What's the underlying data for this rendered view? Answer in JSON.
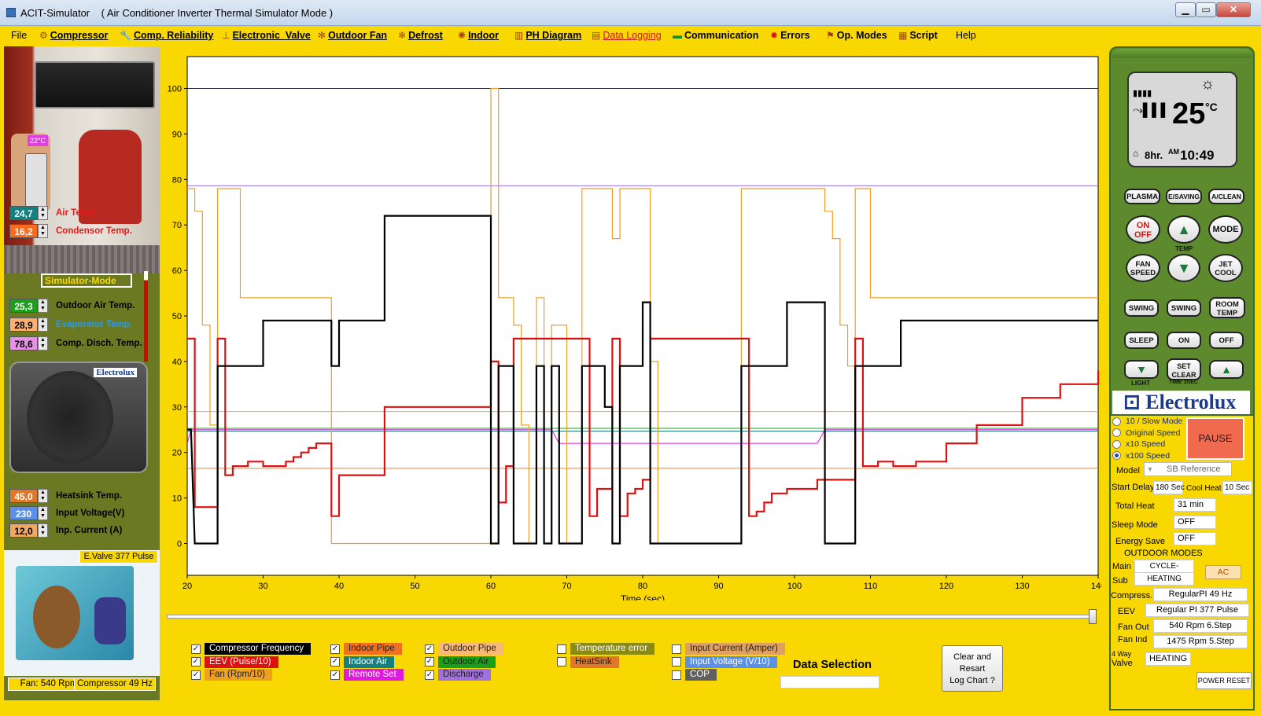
{
  "window": {
    "app_name": "ACIT-Simulator",
    "subtitle": "( Air Conditioner Inverter Thermal Simulator  Mode )",
    "min": "▁",
    "max": "▭",
    "close": "✕"
  },
  "menu": [
    {
      "label": "File",
      "icon": "",
      "style": "plain"
    },
    {
      "label": "Compressor",
      "icon": "compressor-icon",
      "style": "u"
    },
    {
      "label": "Comp. Reliability",
      "icon": "wrench-icon",
      "style": "u"
    },
    {
      "label": "Electronic_Valve",
      "icon": "valve-icon",
      "style": "u"
    },
    {
      "label": "Outdoor Fan",
      "icon": "fan-icon",
      "style": "u"
    },
    {
      "label": "Defrost",
      "icon": "defrost-icon",
      "style": "u"
    },
    {
      "label": "Indoor",
      "icon": "indoor-icon",
      "style": "u"
    },
    {
      "label": "PH Diagram",
      "icon": "chart-icon",
      "style": "u"
    },
    {
      "label": "Data Logging",
      "icon": "log-icon",
      "style": "u-red"
    },
    {
      "label": "Communication",
      "icon": "comm-icon",
      "style": "b"
    },
    {
      "label": "Errors",
      "icon": "error-icon",
      "style": "b"
    },
    {
      "label": "Op. Modes",
      "icon": "modes-icon",
      "style": "b"
    },
    {
      "label": "Script",
      "icon": "script-icon",
      "style": "b"
    },
    {
      "label": "Help",
      "icon": "",
      "style": "plain"
    }
  ],
  "left": {
    "remote_temp": "22°C",
    "air_temp": {
      "value": "24,7",
      "label": "Air Temp.",
      "bg": "#148080",
      "color": "#e81818"
    },
    "condensor_temp": {
      "value": "16,2",
      "label": "Condensor Temp.",
      "bg": "#ff6a1a",
      "color": "#e81818"
    },
    "sim_mode": "Simulator-Mode",
    "outdoor_air": {
      "value": "25,3",
      "label": "Outdoor Air Temp.",
      "bg": "#1aa01a"
    },
    "evaporator": {
      "value": "28,9",
      "label": "Evaporator Temp.",
      "bg": "#ffb070",
      "color": "#2a9ae8"
    },
    "comp_disch": {
      "value": "78,6",
      "label": "Comp. Disch. Temp.",
      "bg": "#e890e8"
    },
    "outdoor_brand": "Electrolux",
    "heatsink": {
      "value": "45,0",
      "label": "Heatsink Temp.",
      "bg": "#e07828"
    },
    "input_voltage": {
      "value": "230",
      "label": "Input Voltage(V)",
      "bg": "#5a90e8"
    },
    "input_current": {
      "value": "12,0",
      "label": "Inp. Current (A)",
      "bg": "#f0a860"
    },
    "evalve": "E.Valve 377 Pulse",
    "fan": "Fan: 540 Rpm",
    "compressor": "Compressor 49 Hz"
  },
  "chart_data": {
    "type": "line",
    "title": "",
    "xlabel": "Time (sec)",
    "ylabel": "",
    "xlim": [
      20,
      140
    ],
    "ylim": [
      -7,
      107
    ],
    "x_ticks": [
      20,
      30,
      40,
      50,
      60,
      70,
      80,
      90,
      100,
      110,
      120,
      130,
      140
    ],
    "y_ticks": [
      0,
      10,
      20,
      30,
      40,
      50,
      60,
      70,
      80,
      90,
      100
    ],
    "grid": false,
    "series": [
      {
        "name": "Compressor Frequency",
        "color": "#000000",
        "points": [
          [
            20,
            25
          ],
          [
            20.5,
            25
          ],
          [
            21,
            0
          ],
          [
            24,
            0
          ],
          [
            24,
            39
          ],
          [
            30,
            39
          ],
          [
            30,
            49
          ],
          [
            39,
            49
          ],
          [
            39,
            39
          ],
          [
            40,
            39
          ],
          [
            40,
            49
          ],
          [
            46,
            49
          ],
          [
            46,
            72
          ],
          [
            60,
            72
          ],
          [
            60,
            0
          ],
          [
            61,
            0
          ],
          [
            61,
            39
          ],
          [
            63,
            39
          ],
          [
            63,
            0
          ],
          [
            66,
            0
          ],
          [
            66,
            39
          ],
          [
            67,
            39
          ],
          [
            67,
            0
          ],
          [
            68,
            0
          ],
          [
            68,
            39
          ],
          [
            69,
            39
          ],
          [
            69,
            0
          ],
          [
            72,
            0
          ],
          [
            72,
            39
          ],
          [
            75,
            39
          ],
          [
            75,
            30
          ],
          [
            76,
            30
          ],
          [
            76,
            0
          ],
          [
            77,
            0
          ],
          [
            77,
            39
          ],
          [
            80,
            39
          ],
          [
            80,
            53
          ],
          [
            81,
            53
          ],
          [
            81,
            0
          ],
          [
            93,
            0
          ],
          [
            93,
            39
          ],
          [
            99,
            39
          ],
          [
            99,
            53
          ],
          [
            104,
            53
          ],
          [
            104,
            0
          ],
          [
            108,
            0
          ],
          [
            108,
            39
          ],
          [
            114,
            39
          ],
          [
            114,
            49
          ],
          [
            140,
            49
          ]
        ]
      },
      {
        "name": "EEV (Pulse/10)",
        "color": "#dd1111",
        "points": [
          [
            20,
            45
          ],
          [
            21,
            45
          ],
          [
            21,
            8
          ],
          [
            24,
            8
          ],
          [
            24,
            45
          ],
          [
            25,
            45
          ],
          [
            25,
            15
          ],
          [
            26,
            15
          ],
          [
            26,
            17
          ],
          [
            28,
            17
          ],
          [
            28,
            18
          ],
          [
            30,
            18
          ],
          [
            30,
            17
          ],
          [
            33,
            17
          ],
          [
            33,
            18
          ],
          [
            34,
            18
          ],
          [
            34,
            19
          ],
          [
            35,
            19
          ],
          [
            35,
            20
          ],
          [
            36,
            20
          ],
          [
            36,
            21
          ],
          [
            37,
            21
          ],
          [
            37,
            22
          ],
          [
            39,
            22
          ],
          [
            39,
            6
          ],
          [
            40,
            6
          ],
          [
            40,
            15
          ],
          [
            46,
            15
          ],
          [
            46,
            30
          ],
          [
            60,
            30
          ],
          [
            60,
            40
          ],
          [
            61,
            40
          ],
          [
            61,
            9
          ],
          [
            62,
            9
          ],
          [
            62,
            17
          ],
          [
            63,
            17
          ],
          [
            63,
            45
          ],
          [
            73,
            45
          ],
          [
            73,
            6
          ],
          [
            74,
            6
          ],
          [
            74,
            12
          ],
          [
            76,
            12
          ],
          [
            76,
            45
          ],
          [
            77,
            45
          ],
          [
            77,
            6
          ],
          [
            78,
            6
          ],
          [
            78,
            11
          ],
          [
            79,
            11
          ],
          [
            79,
            12
          ],
          [
            80,
            12
          ],
          [
            80,
            14
          ],
          [
            81,
            14
          ],
          [
            81,
            45
          ],
          [
            94,
            45
          ],
          [
            94,
            6
          ],
          [
            95,
            6
          ],
          [
            95,
            7
          ],
          [
            96,
            7
          ],
          [
            96,
            9
          ],
          [
            97,
            9
          ],
          [
            97,
            11
          ],
          [
            99,
            11
          ],
          [
            99,
            12
          ],
          [
            103,
            12
          ],
          [
            103,
            14
          ],
          [
            108,
            14
          ],
          [
            108,
            45
          ],
          [
            109,
            45
          ],
          [
            109,
            17
          ],
          [
            111,
            17
          ],
          [
            111,
            18
          ],
          [
            113,
            18
          ],
          [
            113,
            17
          ],
          [
            116,
            17
          ],
          [
            116,
            18
          ],
          [
            120,
            18
          ],
          [
            120,
            22
          ],
          [
            124,
            22
          ],
          [
            124,
            26
          ],
          [
            130,
            26
          ],
          [
            130,
            32
          ],
          [
            135,
            32
          ],
          [
            135,
            35
          ],
          [
            140,
            35
          ],
          [
            140,
            38
          ]
        ]
      },
      {
        "name": "Fan (Rpm/10)",
        "color": "#f0a020",
        "points": [
          [
            20,
            78
          ],
          [
            21,
            78
          ],
          [
            21,
            73
          ],
          [
            22,
            73
          ],
          [
            22,
            48
          ],
          [
            23,
            48
          ],
          [
            23,
            26
          ],
          [
            24,
            26
          ],
          [
            24,
            78
          ],
          [
            27,
            78
          ],
          [
            27,
            54
          ],
          [
            39,
            54
          ],
          [
            39,
            0
          ],
          [
            60,
            0
          ],
          [
            60,
            100
          ],
          [
            61,
            100
          ],
          [
            61,
            54
          ],
          [
            63,
            54
          ],
          [
            63,
            48
          ],
          [
            64,
            48
          ],
          [
            64,
            26
          ],
          [
            65,
            26
          ],
          [
            65,
            0
          ],
          [
            66,
            0
          ],
          [
            66,
            54
          ],
          [
            67,
            54
          ],
          [
            67,
            0
          ],
          [
            68,
            0
          ],
          [
            68,
            48
          ],
          [
            70,
            48
          ],
          [
            70,
            0
          ],
          [
            72,
            0
          ],
          [
            72,
            78
          ],
          [
            76,
            78
          ],
          [
            76,
            67
          ],
          [
            77,
            67
          ],
          [
            77,
            78
          ],
          [
            81,
            78
          ],
          [
            81,
            40
          ],
          [
            82,
            40
          ],
          [
            82,
            0
          ],
          [
            93,
            0
          ],
          [
            93,
            78
          ],
          [
            104,
            78
          ],
          [
            104,
            73
          ],
          [
            105,
            73
          ],
          [
            105,
            67
          ],
          [
            106,
            67
          ],
          [
            106,
            48
          ],
          [
            107,
            48
          ],
          [
            107,
            39
          ],
          [
            108,
            39
          ],
          [
            108,
            78
          ],
          [
            110,
            78
          ],
          [
            110,
            54
          ],
          [
            140,
            54
          ]
        ]
      },
      {
        "name": "Indoor Pipe",
        "color": "#f08030",
        "points": [
          [
            20,
            16.5
          ],
          [
            140,
            16.5
          ]
        ]
      },
      {
        "name": "Outdoor Pipe",
        "color": "#f0a850",
        "points": [
          [
            20,
            29
          ],
          [
            140,
            29
          ]
        ]
      },
      {
        "name": "Indoor Air",
        "color": "#168080",
        "points": [
          [
            20,
            24.7
          ],
          [
            140,
            24.7
          ]
        ]
      },
      {
        "name": "Outdoor Air",
        "color": "#18a018",
        "points": [
          [
            20,
            25.3
          ],
          [
            140,
            25.3
          ]
        ]
      },
      {
        "name": "Remote Set",
        "color": "#e018e0",
        "points": [
          [
            20,
            22
          ],
          [
            20.5,
            25
          ],
          [
            68,
            25
          ],
          [
            69,
            22
          ],
          [
            103,
            22
          ],
          [
            104,
            25
          ],
          [
            140,
            25
          ]
        ]
      },
      {
        "name": "Discharge",
        "color": "#9a70d8",
        "points": [
          [
            20,
            78.6
          ],
          [
            140,
            78.6
          ]
        ]
      },
      {
        "name": "Reference",
        "color": "#202030",
        "points": [
          [
            20,
            100
          ],
          [
            140,
            100
          ]
        ]
      }
    ]
  },
  "legend": {
    "col1": [
      {
        "label": "Compressor Frequency",
        "checked": true,
        "bg": "#000000",
        "color": "#ffffff"
      },
      {
        "label": "EEV (Pulse/10)",
        "checked": true,
        "bg": "#dd1111",
        "color": "#ffffff"
      },
      {
        "label": "Fan (Rpm/10)",
        "checked": true,
        "bg": "#f0a020",
        "color": "#222222"
      }
    ],
    "col2": [
      {
        "label": "Indoor Pipe",
        "checked": true,
        "bg": "#f07020",
        "color": "#222222"
      },
      {
        "label": "Indoor Air",
        "checked": true,
        "bg": "#148080",
        "color": "#ffffff"
      },
      {
        "label": "Remote Set",
        "checked": true,
        "bg": "#e018e0",
        "color": "#ffffff"
      }
    ],
    "col3": [
      {
        "label": "Outdoor Pipe",
        "checked": true,
        "bg": "#f8b878",
        "color": "#222222"
      },
      {
        "label": "Outdoor Air",
        "checked": true,
        "bg": "#18a018",
        "color": "#222222"
      },
      {
        "label": "Discharge",
        "checked": true,
        "bg": "#a070e0",
        "color": "#222222"
      }
    ],
    "col4": [
      {
        "label": "Temperature error",
        "checked": false,
        "bg": "#8a8a10",
        "color": "#ffffff"
      },
      {
        "label": "HeatSink",
        "checked": false,
        "bg": "#e07828",
        "color": "#222222"
      }
    ],
    "col5": [
      {
        "label": "Input Current (Amper)",
        "checked": false,
        "bg": "#e0a060",
        "color": "#222222"
      },
      {
        "label": "Input Voltage (V/10)",
        "checked": false,
        "bg": "#5a90e8",
        "color": "#ffffff"
      },
      {
        "label": "COP",
        "checked": false,
        "bg": "#606060",
        "color": "#ffffff"
      }
    ],
    "data_selection": "Data Selection",
    "clear_btn": [
      "Clear and",
      "Resart",
      "Log Chart ?"
    ]
  },
  "remote": {
    "temp": "25",
    "unit": "°C",
    "timer": "8hr.",
    "ampm": "AM",
    "clock": "10:49",
    "buttons": {
      "plasma": "PLASMA",
      "esaving": "E/SAVING",
      "aclean": "A/CLEAN",
      "on": "ON",
      "off": "OFF",
      "mode": "MODE",
      "temp": "TEMP",
      "fan": "FAN",
      "speed": "SPEED",
      "jet": "JET",
      "cool": "COOL",
      "swing1": "SWING",
      "swing2": "SWING",
      "room": "ROOM",
      "roomtemp": "TEMP",
      "sleep": "SLEEP",
      "on2": "ON",
      "off2": "OFF",
      "set": "SET",
      "clear": "CLEAR",
      "light": "LIGHT",
      "time": "TIME 3SEC"
    },
    "brand": "Electrolux"
  },
  "speed": {
    "options": [
      {
        "label": "10 / Slow Mode",
        "selected": false
      },
      {
        "label": "Original Speed",
        "selected": false
      },
      {
        "label": "x10 Speed",
        "selected": false
      },
      {
        "label": "x100 Speed",
        "selected": true
      }
    ],
    "pause": "PAUSE"
  },
  "params": {
    "model_label": "Model",
    "model_value": "SB Reference",
    "start_delay_label": "Start Delay",
    "start_delay": "180 Sec",
    "cool_heat_label": "Cool Heat",
    "cool_heat": "10 Sec",
    "total_heat_label": "Total Heat",
    "total_heat": "31 min",
    "sleep_label": "Sleep Mode",
    "sleep": "OFF",
    "energy_label": "Energy Save",
    "energy": "OFF",
    "outdoor_modes": "OUTDOOR MODES",
    "main_label": "Main",
    "main_value": "CYCLE-",
    "sub_label": "Sub",
    "sub_value": "HEATING",
    "ac_badge": "AC",
    "compress_label": "Compress.",
    "compress_value": "RegularPI    49 Hz",
    "eev_label": "EEV",
    "eev_value": "Regular PI    377 Pulse",
    "fan_out_label": "Fan Out",
    "fan_out_value": "540 Rpm   6.Step",
    "fan_ind_label": "Fan Ind",
    "fan_ind_value": "1475 Rpm   5.Step",
    "four_way_label1": "4 Way",
    "four_way_label2": "Valve",
    "four_way_value": "HEATING",
    "power_reset": "POWER RESET"
  }
}
